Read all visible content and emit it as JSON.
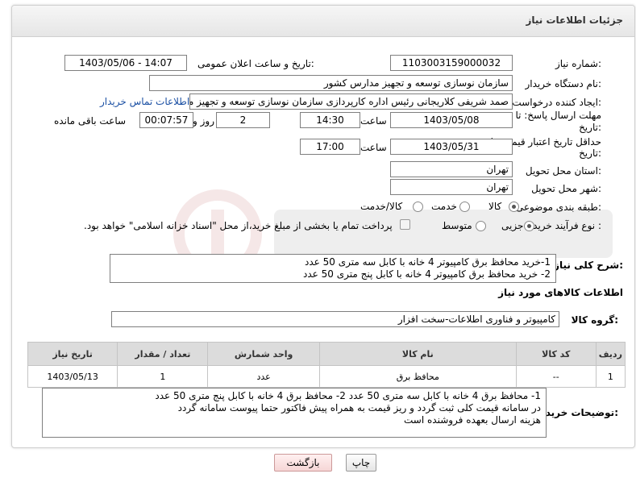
{
  "header": {
    "title": "جزئیات اطلاعات نیاز"
  },
  "fields": {
    "need_number_label": "شماره نیاز:",
    "need_number": "1103003159000032",
    "announce_label": "تاریخ و ساعت اعلان عمومی:",
    "announce_value": "1403/05/06 - 14:07",
    "buyer_org_label": "نام دستگاه خریدار:",
    "buyer_org": "سازمان نوسازی  توسعه و تجهیز مدارس کشور",
    "creator_label": "ایجاد کننده درخواست:",
    "creator": "صمد شریفی کلاریجانی رئیس اداره کارپردازی سازمان نوسازی  توسعه و تجهیز مدارس کشور",
    "contact_link": "اطلاعات تماس خریدار",
    "deadline_label_1": "مهلت ارسال پاسخ: تا",
    "deadline_label_2": "تاریخ:",
    "deadline_date": "1403/05/08",
    "time_label": "ساعت",
    "deadline_time": "14:30",
    "days_value": "2",
    "days_label": "روز و",
    "remaining_value": "00:07:57",
    "remaining_label": "ساعت باقی مانده",
    "validity_label_1": "حداقل تاریخ اعتبار قیمت: تا",
    "validity_label_2": "تاریخ:",
    "validity_date": "1403/05/31",
    "validity_time": "17:00",
    "province_label": "استان محل تحویل:",
    "province": "تهران",
    "city_label": "شهر محل تحویل:",
    "city": "تهران",
    "category_label": "طبقه بندی موضوعی:",
    "category_options": [
      "کالا",
      "خدمت",
      "کالا/خدمت"
    ],
    "process_label": "نوع فرآیند خرید :",
    "process_options": [
      "جزیی",
      "متوسط"
    ],
    "payment_note": "پرداخت تمام یا بخشی از مبلغ خرید،از محل \"اسناد خزانه اسلامی\" خواهد بود."
  },
  "summary": {
    "label": "شرح کلی نیاز:",
    "lines": [
      "1-خرید محافظ برق کامپیوتر 4 خانه با کابل سه متری 50 عدد",
      "2- خرید محافظ برق کامپیوتر 4 خانه با کابل پنج متری 50 عدد"
    ]
  },
  "goods": {
    "section_title": "اطلاعات کالاهای مورد نیاز",
    "group_label": "گروه کالا:",
    "group_value": "کامپیوتر و فناوری اطلاعات-سخت افزار",
    "columns": [
      "ردیف",
      "کد کالا",
      "نام کالا",
      "واحد شمارش",
      "تعداد / مقدار",
      "تاریخ نیاز"
    ],
    "rows": [
      {
        "row": "1",
        "code": "--",
        "name": "محافظ برق",
        "unit": "عدد",
        "qty": "1",
        "date": "1403/05/13"
      }
    ]
  },
  "buyer_notes": {
    "label": "توضیحات خریدار:",
    "lines": [
      "1- محافظ برق 4 خانه با کابل سه متری 50 عدد 2- محافظ برق 4 خانه با کابل پنج متری 50 عدد",
      "در سامانه قیمت کلی ثبت گردد و ریز قیمت به همراه پیش فاکتور حتما پیوست سامانه گردد",
      "هزینه ارسال بعهده فروشنده است"
    ]
  },
  "buttons": {
    "print": "چاپ",
    "back": "بازگشت"
  },
  "colors": {
    "link": "#1a4fa3",
    "header_bg": "#eeeeee",
    "table_header": "#dcdcdc"
  }
}
